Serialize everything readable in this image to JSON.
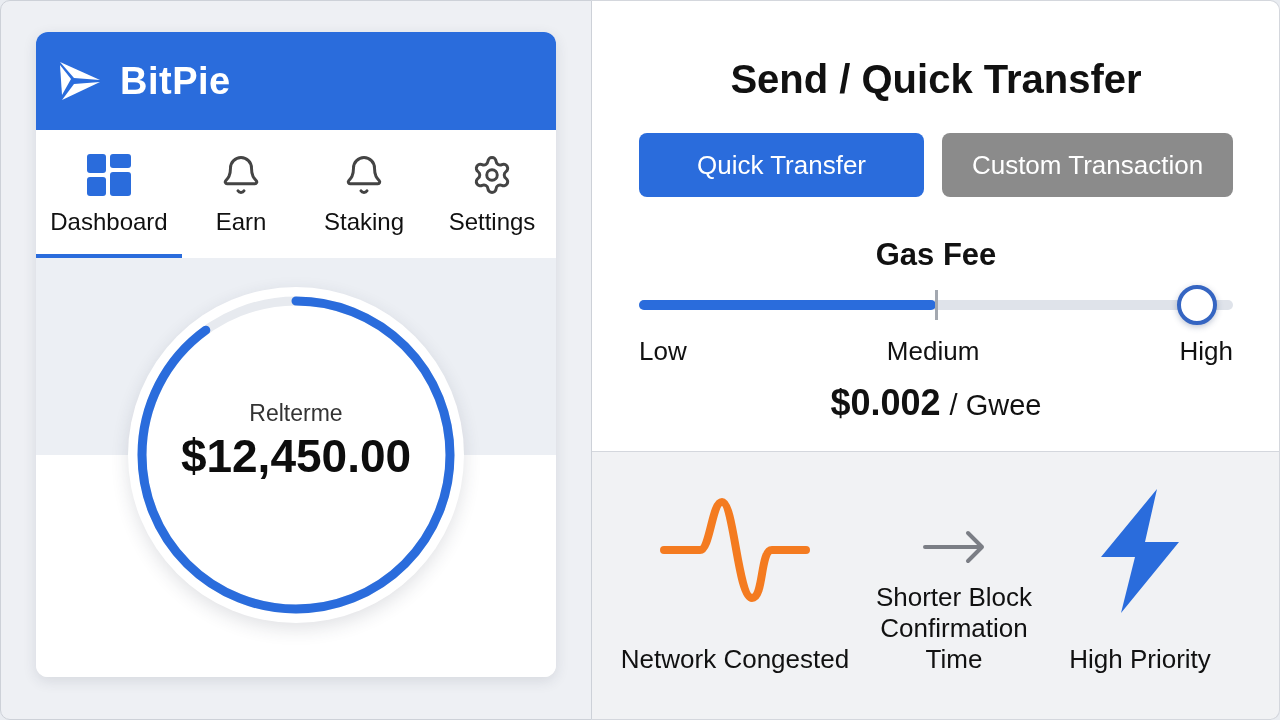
{
  "app": {
    "brand": "BitPie"
  },
  "tabs": [
    {
      "label": "Dashboard",
      "kind": "dashboard",
      "selected": true
    },
    {
      "label": "Earn",
      "kind": "bell",
      "selected": false
    },
    {
      "label": "Staking",
      "kind": "bell",
      "selected": false
    },
    {
      "label": "Settings",
      "kind": "gear",
      "selected": false
    }
  ],
  "balance": {
    "label": "Relterme",
    "amount": "$12,450.00",
    "level": 0.9
  },
  "transfer": {
    "title": "Send / Quick Transfer",
    "modes": [
      {
        "label": "Quick Transfer",
        "selected": true
      },
      {
        "label": "Custom Transaction",
        "selected": false
      }
    ],
    "gas": {
      "title": "Gas Fee",
      "level": 0.5,
      "stops": [
        {
          "label": "Low",
          "selected": false
        },
        {
          "label": "Medium",
          "selected": false
        },
        {
          "label": "High",
          "selected": true
        }
      ],
      "fee": "$0.002",
      "unit": "/ Gwee"
    }
  },
  "flow": [
    {
      "kind": "wave",
      "label": "Network Congested"
    },
    {
      "kind": "arrow",
      "label": "Shorter Block Confirmation Time"
    },
    {
      "kind": "bolt",
      "label": "High Priority"
    }
  ]
}
